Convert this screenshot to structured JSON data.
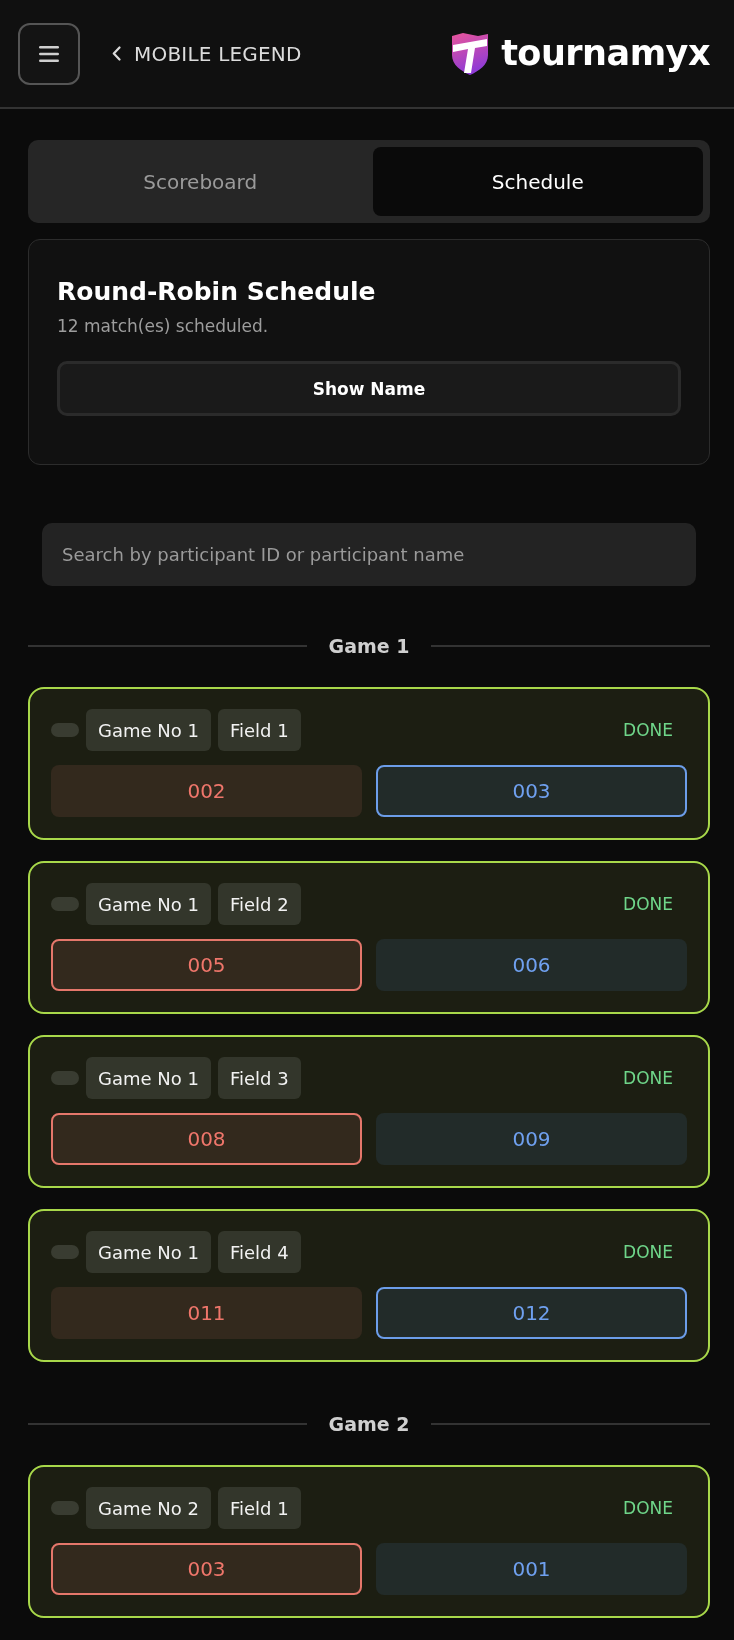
{
  "header": {
    "back_label": "MOBILE LEGEND",
    "logo_text": "tournamyx"
  },
  "tabs": [
    {
      "label": "Scoreboard",
      "selected": false
    },
    {
      "label": "Schedule",
      "selected": true
    }
  ],
  "schedule_card": {
    "title": "Round-Robin Schedule",
    "subtitle": "12 match(es) scheduled.",
    "button": "Show Name"
  },
  "search": {
    "placeholder": "Search by participant ID or participant name"
  },
  "groups": [
    {
      "title": "Game 1",
      "matches": [
        {
          "game_no": "Game No 1",
          "field": "Field 1",
          "status": "DONE",
          "teams": [
            {
              "id": "002",
              "winner": false
            },
            {
              "id": "003",
              "winner": true
            }
          ]
        },
        {
          "game_no": "Game No 1",
          "field": "Field 2",
          "status": "DONE",
          "teams": [
            {
              "id": "005",
              "winner": true
            },
            {
              "id": "006",
              "winner": false
            }
          ]
        },
        {
          "game_no": "Game No 1",
          "field": "Field 3",
          "status": "DONE",
          "teams": [
            {
              "id": "008",
              "winner": true
            },
            {
              "id": "009",
              "winner": false
            }
          ]
        },
        {
          "game_no": "Game No 1",
          "field": "Field 4",
          "status": "DONE",
          "teams": [
            {
              "id": "011",
              "winner": false
            },
            {
              "id": "012",
              "winner": true
            }
          ]
        }
      ]
    },
    {
      "title": "Game 2",
      "matches": [
        {
          "game_no": "Game No 2",
          "field": "Field 1",
          "status": "DONE",
          "teams": [
            {
              "id": "003",
              "winner": true
            },
            {
              "id": "001",
              "winner": false
            }
          ]
        }
      ]
    }
  ]
}
